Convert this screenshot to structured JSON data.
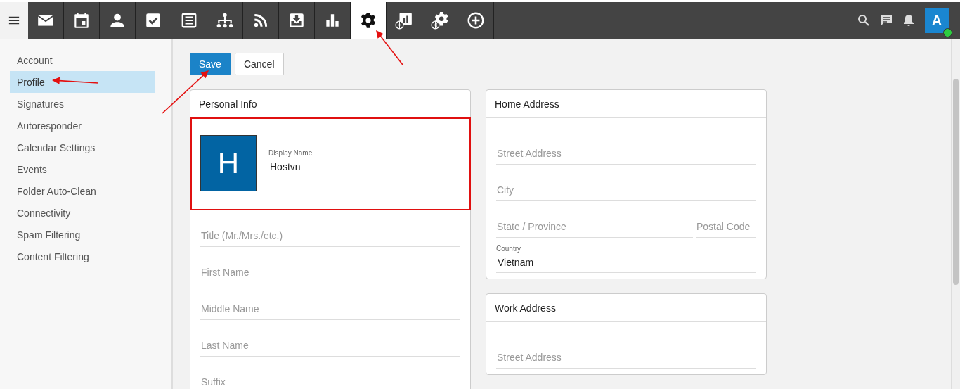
{
  "toolbar": {
    "apps": [
      {
        "selected": false
      },
      {
        "selected": false
      },
      {
        "selected": false
      },
      {
        "selected": false
      },
      {
        "selected": false
      },
      {
        "selected": false
      },
      {
        "selected": false
      },
      {
        "selected": false
      },
      {
        "selected": false
      },
      {
        "selected": true
      },
      {
        "selected": false
      },
      {
        "selected": false
      },
      {
        "selected": false
      }
    ],
    "avatar": {
      "letter": "A",
      "online": true
    }
  },
  "sidebar": {
    "items": [
      {
        "label": "Account",
        "selected": false
      },
      {
        "label": "Profile",
        "selected": true
      },
      {
        "label": "Signatures",
        "selected": false
      },
      {
        "label": "Autoresponder",
        "selected": false
      },
      {
        "label": "Calendar Settings",
        "selected": false
      },
      {
        "label": "Events",
        "selected": false
      },
      {
        "label": "Folder Auto-Clean",
        "selected": false
      },
      {
        "label": "Connectivity",
        "selected": false
      },
      {
        "label": "Spam Filtering",
        "selected": false
      },
      {
        "label": "Content Filtering",
        "selected": false
      }
    ]
  },
  "actions": [
    {
      "label": "Save",
      "kind": "primary"
    },
    {
      "label": "Cancel",
      "kind": "secondary"
    }
  ],
  "personal_info": {
    "title": "Personal Info",
    "photo_letter": "H",
    "display_name": {
      "label": "Display Name",
      "value": "Hostvn"
    },
    "highlighted": true,
    "fields": [
      {
        "placeholder": "Title (Mr./Mrs./etc.)"
      },
      {
        "placeholder": "First Name"
      },
      {
        "placeholder": "Middle Name"
      },
      {
        "placeholder": "Last Name"
      },
      {
        "placeholder": "Suffix"
      }
    ]
  },
  "home_address": {
    "title": "Home Address",
    "street": {
      "placeholder": "Street Address"
    },
    "city": {
      "placeholder": "City"
    },
    "state": {
      "placeholder": "State / Province"
    },
    "postal": {
      "placeholder": "Postal Code"
    },
    "country": {
      "label": "Country",
      "value": "Vietnam"
    }
  },
  "work_address": {
    "title": "Work Address",
    "street": {
      "placeholder": "Street Address"
    }
  }
}
